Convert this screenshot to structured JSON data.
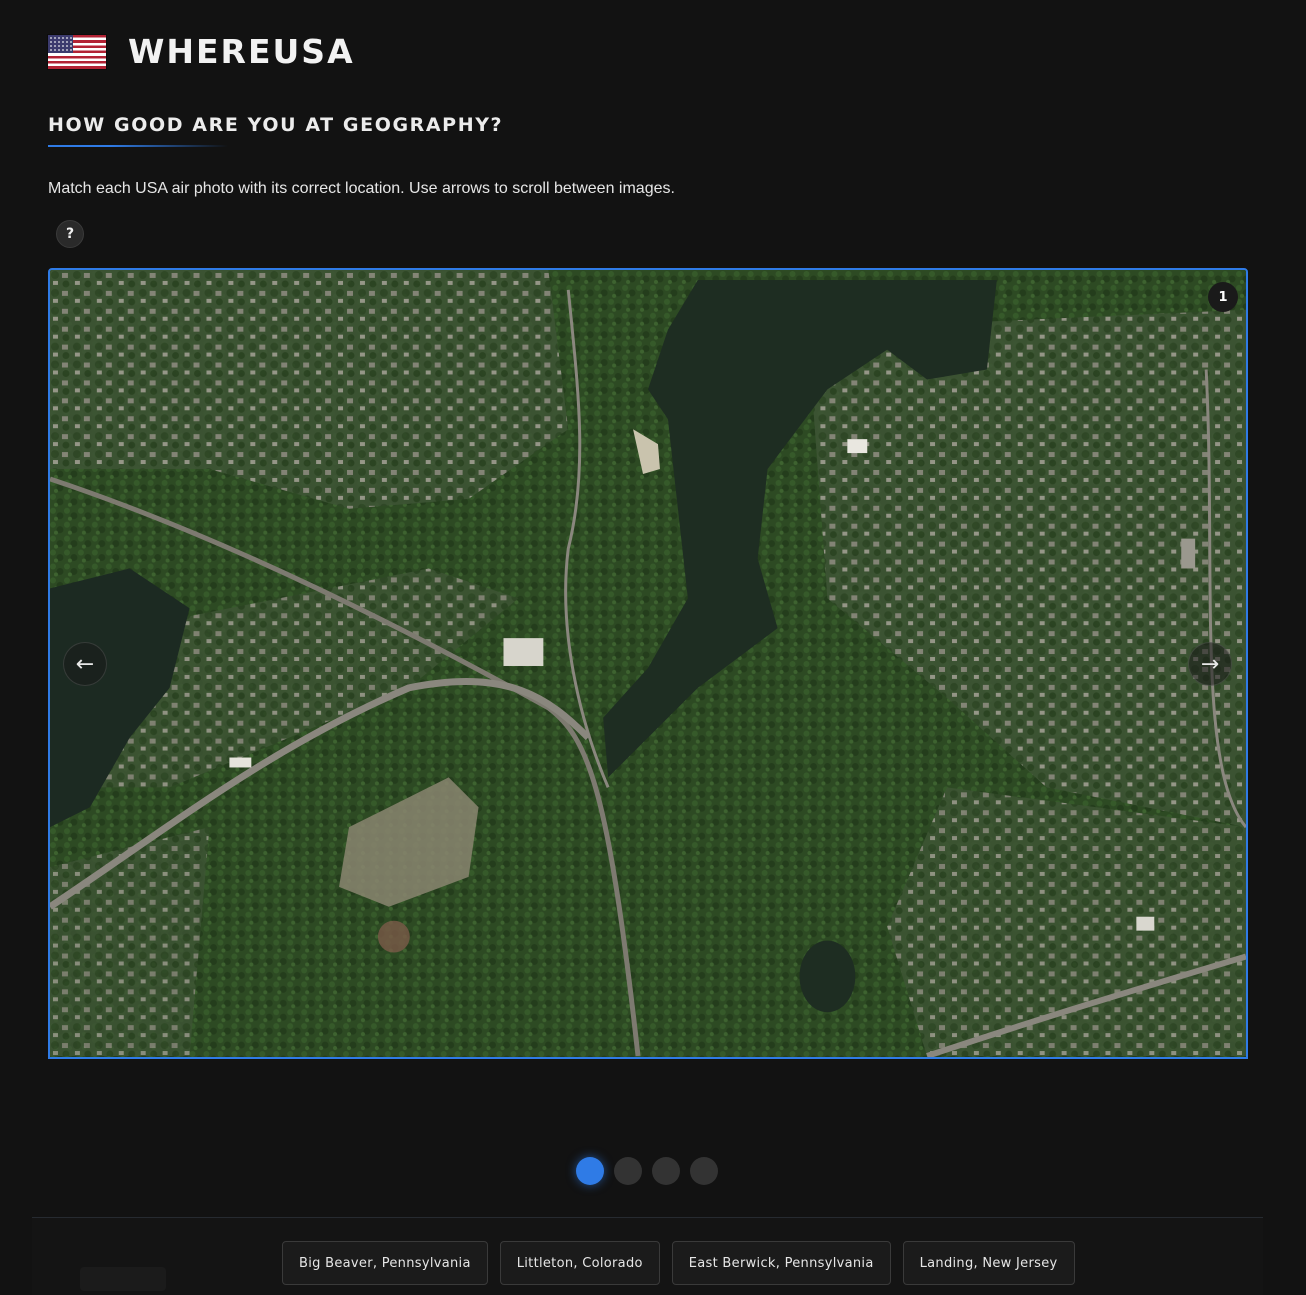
{
  "app": {
    "brand": "WHEREUSA",
    "flag_icon": "us-flag-icon"
  },
  "main": {
    "heading": "HOW GOOD ARE YOU AT GEOGRAPHY?",
    "instructions": "Match each USA air photo with its correct location. Use arrows to scroll between images.",
    "help_label": "?",
    "photo_index": "1",
    "prev_arrow": "←",
    "next_arrow": "→",
    "image_alt_subject": "aerial photo of a lake with surrounding forest and town",
    "dots": {
      "count": 4,
      "active": 0
    }
  },
  "options": [
    {
      "label": "Big Beaver, Pennsylvania"
    },
    {
      "label": "Littleton, Colorado"
    },
    {
      "label": "East Berwick, Pennsylvania"
    },
    {
      "label": "Landing, New Jersey"
    }
  ],
  "colors": {
    "background": "#121212",
    "accent": "#2f7be6",
    "option_bg": "#1b1b1b",
    "option_border": "#3a3a3a"
  }
}
